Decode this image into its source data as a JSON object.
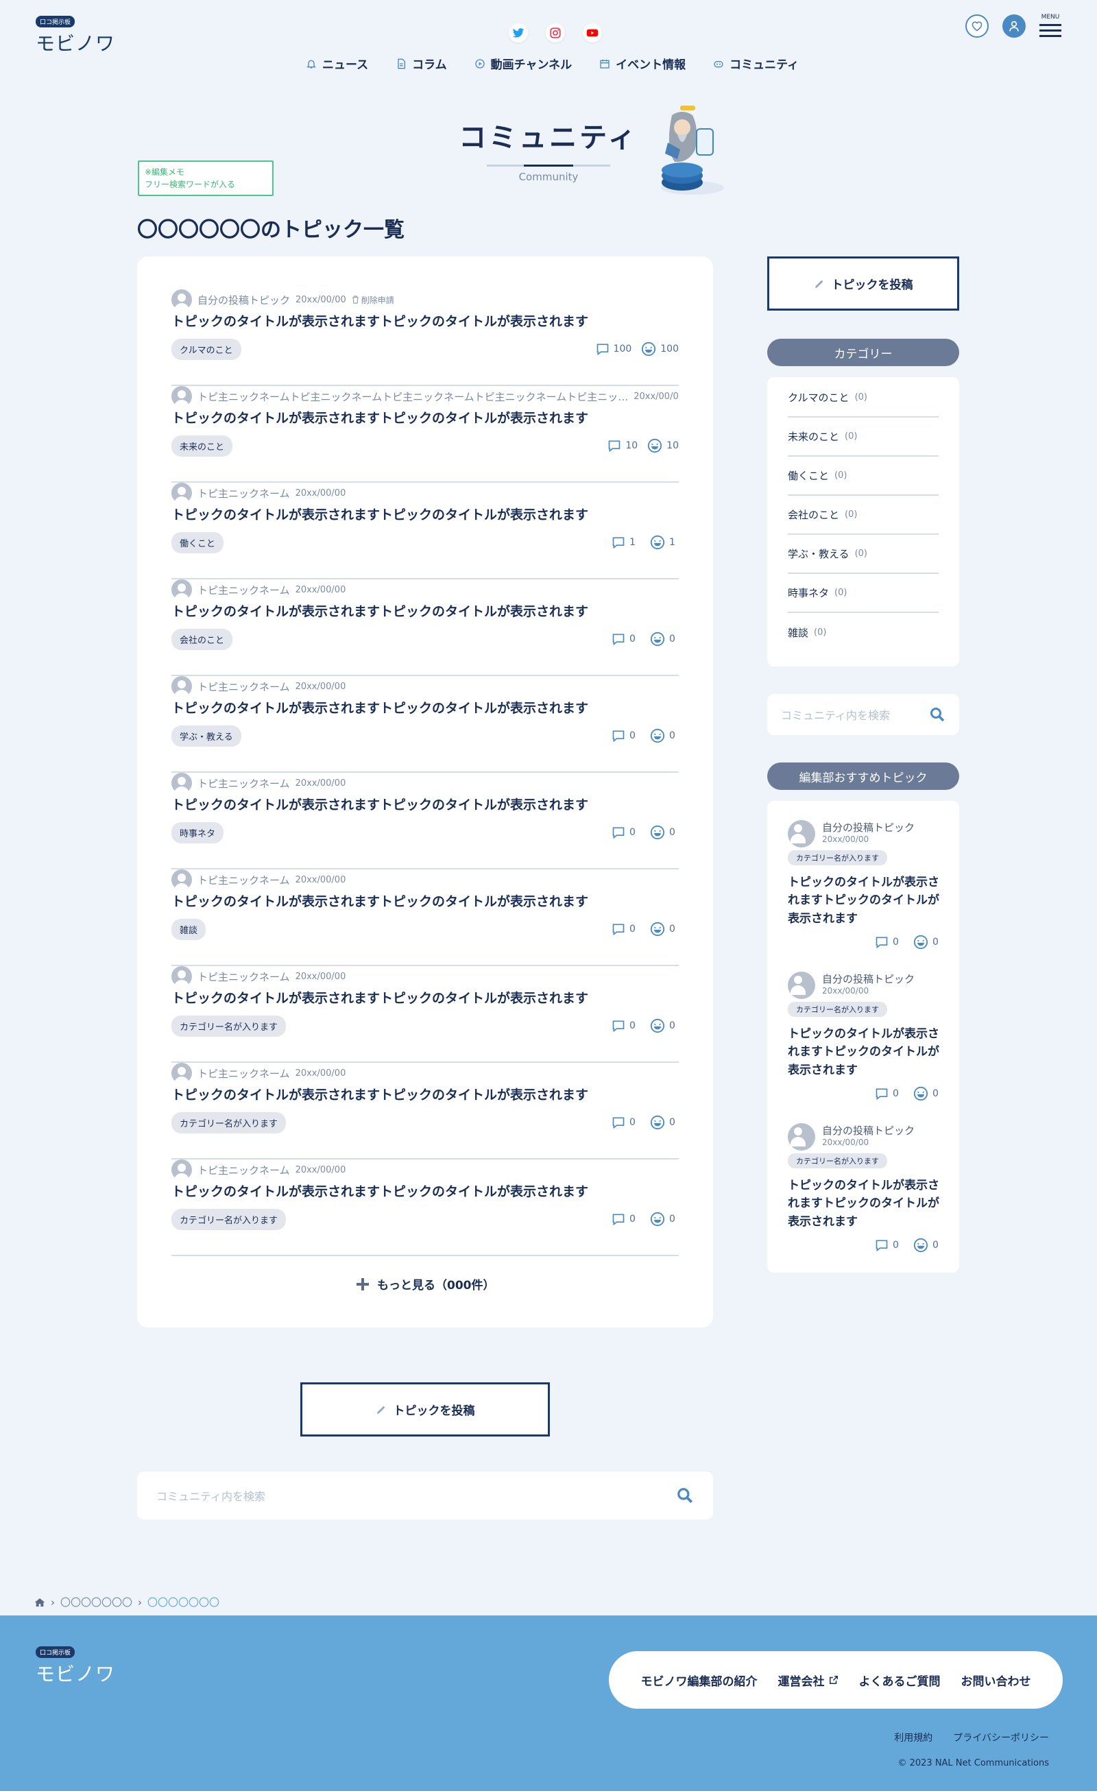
{
  "header": {
    "logo_badge": "口コ掲示板",
    "logo_text": "モビノワ",
    "menu_label": "MENU",
    "nav": [
      {
        "label": "ニュース",
        "icon": "bell-icon"
      },
      {
        "label": "コラム",
        "icon": "document-icon"
      },
      {
        "label": "動画チャンネル",
        "icon": "play-icon"
      },
      {
        "label": "イベント情報",
        "icon": "calendar-icon"
      },
      {
        "label": "コミュニティ",
        "icon": "community-icon"
      }
    ],
    "social": [
      "twitter-icon",
      "instagram-icon",
      "youtube-icon"
    ]
  },
  "page": {
    "title": "コミュニティ",
    "subtitle": "Community",
    "memo_line1": "※編集メモ",
    "memo_line2": "フリー検索ワードが入る",
    "list_heading": "〇〇〇〇〇〇のトピック一覧"
  },
  "topics": [
    {
      "author": "自分の投稿トピック",
      "date": "20xx/00/00",
      "delete": "削除申請",
      "title": "トピックのタイトルが表示されますトピックのタイトルが表示されます",
      "category": "クルマのこと",
      "comments": "100",
      "reactions": "100"
    },
    {
      "author": "トピ主ニックネームトピ主ニックネームトピ主ニックネームトピ主ニックネームトピ主ニッ…",
      "date": "20xx/00/00",
      "delete": "",
      "title": "トピックのタイトルが表示されますトピックのタイトルが表示されます",
      "category": "未来のこと",
      "comments": "10",
      "reactions": "10"
    },
    {
      "author": "トピ主ニックネーム",
      "date": "20xx/00/00",
      "delete": "",
      "title": "トピックのタイトルが表示されますトピックのタイトルが表示されます",
      "category": "働くこと",
      "comments": "1",
      "reactions": "1"
    },
    {
      "author": "トピ主ニックネーム",
      "date": "20xx/00/00",
      "delete": "",
      "title": "トピックのタイトルが表示されますトピックのタイトルが表示されます",
      "category": "会社のこと",
      "comments": "0",
      "reactions": "0"
    },
    {
      "author": "トピ主ニックネーム",
      "date": "20xx/00/00",
      "delete": "",
      "title": "トピックのタイトルが表示されますトピックのタイトルが表示されます",
      "category": "学ぶ・教える",
      "comments": "0",
      "reactions": "0"
    },
    {
      "author": "トピ主ニックネーム",
      "date": "20xx/00/00",
      "delete": "",
      "title": "トピックのタイトルが表示されますトピックのタイトルが表示されます",
      "category": "時事ネタ",
      "comments": "0",
      "reactions": "0"
    },
    {
      "author": "トピ主ニックネーム",
      "date": "20xx/00/00",
      "delete": "",
      "title": "トピックのタイトルが表示されますトピックのタイトルが表示されます",
      "category": "雑談",
      "comments": "0",
      "reactions": "0"
    },
    {
      "author": "トピ主ニックネーム",
      "date": "20xx/00/00",
      "delete": "",
      "title": "トピックのタイトルが表示されますトピックのタイトルが表示されます",
      "category": "カテゴリー名が入ります",
      "comments": "0",
      "reactions": "0"
    },
    {
      "author": "トピ主ニックネーム",
      "date": "20xx/00/00",
      "delete": "",
      "title": "トピックのタイトルが表示されますトピックのタイトルが表示されます",
      "category": "カテゴリー名が入ります",
      "comments": "0",
      "reactions": "0"
    },
    {
      "author": "トピ主ニックネーム",
      "date": "20xx/00/00",
      "delete": "",
      "title": "トピックのタイトルが表示されますトピックのタイトルが表示されます",
      "category": "カテゴリー名が入ります",
      "comments": "0",
      "reactions": "0"
    }
  ],
  "more_label": "もっと見る（000件）",
  "sidebar": {
    "post_button": "トピックを投稿",
    "category_heading": "カテゴリー",
    "categories": [
      {
        "label": "クルマのこと",
        "count": "(0)"
      },
      {
        "label": "未来のこと",
        "count": "(0)"
      },
      {
        "label": "働くこと",
        "count": "(0)"
      },
      {
        "label": "会社のこと",
        "count": "(0)"
      },
      {
        "label": "学ぶ・教える",
        "count": "(0)"
      },
      {
        "label": "時事ネタ",
        "count": "(0)"
      },
      {
        "label": "雑談",
        "count": "(0)"
      }
    ],
    "search_placeholder": "コミュニティ内を検索",
    "recommend_heading": "編集部おすすめトピック",
    "recommended": [
      {
        "author": "自分の投稿トピック",
        "date": "20xx/00/00",
        "category": "カテゴリー名が入ります",
        "title": "トピックのタイトルが表示されますトピックのタイトルが表示されます",
        "comments": "0",
        "reactions": "0"
      },
      {
        "author": "自分の投稿トピック",
        "date": "20xx/00/00",
        "category": "カテゴリー名が入ります",
        "title": "トピックのタイトルが表示されますトピックのタイトルが表示されます",
        "comments": "0",
        "reactions": "0"
      },
      {
        "author": "自分の投稿トピック",
        "date": "20xx/00/00",
        "category": "カテゴリー名が入ります",
        "title": "トピックのタイトルが表示されますトピックのタイトルが表示されます",
        "comments": "0",
        "reactions": "0"
      }
    ]
  },
  "bottom": {
    "post_button": "トピックを投稿",
    "search_placeholder": "コミュニティ内を検索"
  },
  "breadcrumb": [
    "〇〇〇〇〇〇〇",
    "〇〇〇〇〇〇〇"
  ],
  "footer": {
    "logo_badge": "口コ掲示板",
    "logo_text": "モビノワ",
    "links": [
      "モビノワ編集部の紹介",
      "運営会社",
      "よくあるご質問",
      "お問い合わせ"
    ],
    "small_links": [
      "利用規約",
      "プライバシーポリシー"
    ],
    "copyright": "© 2023 NAL Net Communications"
  },
  "colors": {
    "navy": "#1a2e55",
    "background": "#eef4fa",
    "footer": "#64a8da",
    "pill": "#6b7a96",
    "memo": "#4bc78a"
  }
}
